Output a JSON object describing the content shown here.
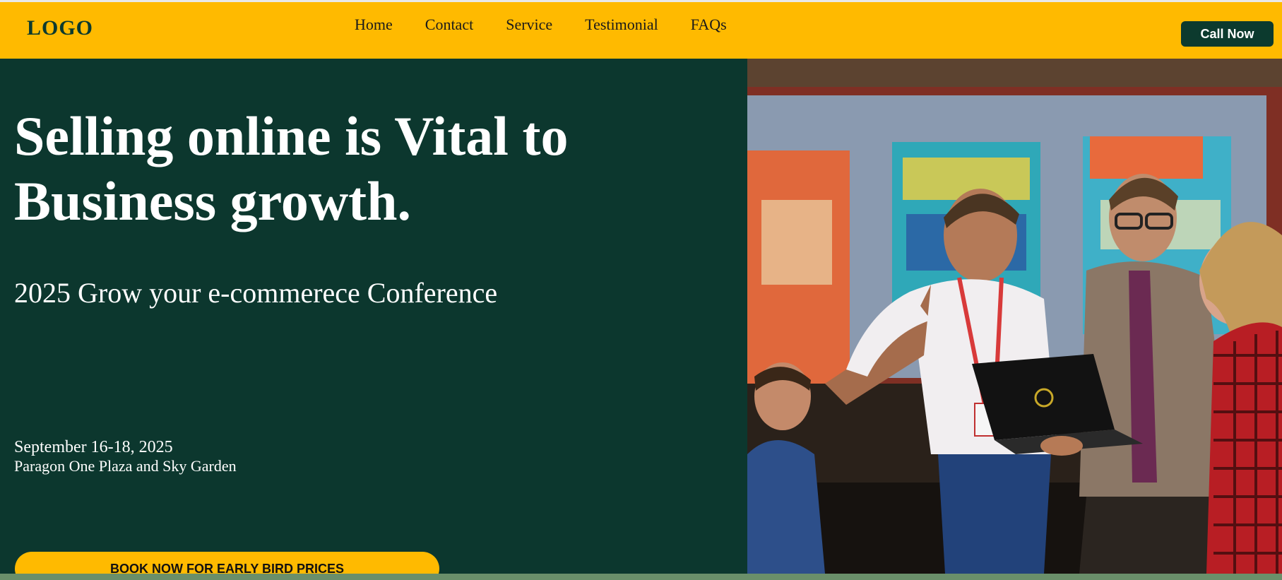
{
  "header": {
    "logo": "LOGO",
    "nav": [
      "Home",
      "Contact",
      "Service",
      "Testimonial",
      "FAQs"
    ],
    "cta": "Call Now"
  },
  "hero": {
    "title": "Selling online is Vital to Business growth.",
    "subtitle": "2025 Grow your e-commerece Conference",
    "date": "September 16-18, 2025",
    "venue": "Paragon One Plaza and Sky Garden",
    "button": "BOOK NOW FOR EARLY BIRD PRICES"
  },
  "colors": {
    "header_bg": "#ffba00",
    "hero_bg": "#0c372e",
    "accent_dark": "#0c3a2e",
    "bottom_strip": "#6a8f6a"
  },
  "image": {
    "icon": "conference-photo"
  }
}
